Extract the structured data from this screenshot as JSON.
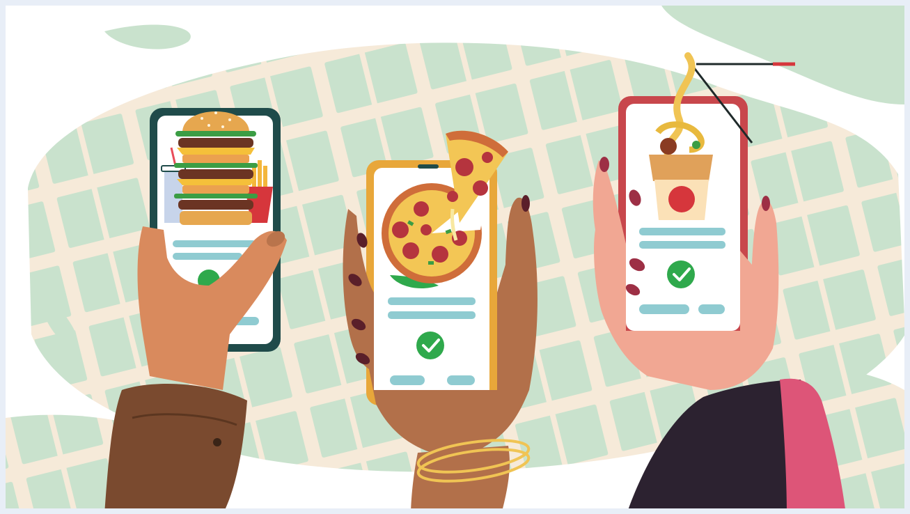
{
  "illustration": {
    "subject": "food-delivery-app-order-confirmation",
    "phones": [
      {
        "food": "burger-and-fries",
        "frame_color": "#1f4b4a",
        "status_icon": "check-circle-icon"
      },
      {
        "food": "pepperoni-pizza",
        "frame_color": "#e8a73a",
        "status_icon": "check-circle-icon"
      },
      {
        "food": "noodles-takeout-box",
        "frame_color": "#c8474c",
        "status_icon": "check-circle-icon"
      }
    ]
  },
  "colors": {
    "page_border": "#e8eef7",
    "background": "#ffffff",
    "map_blocks": "#c9e2cd",
    "map_roads": "#f6ead9",
    "check": "#2fa94c",
    "text_bars": "#8fcbd1"
  }
}
